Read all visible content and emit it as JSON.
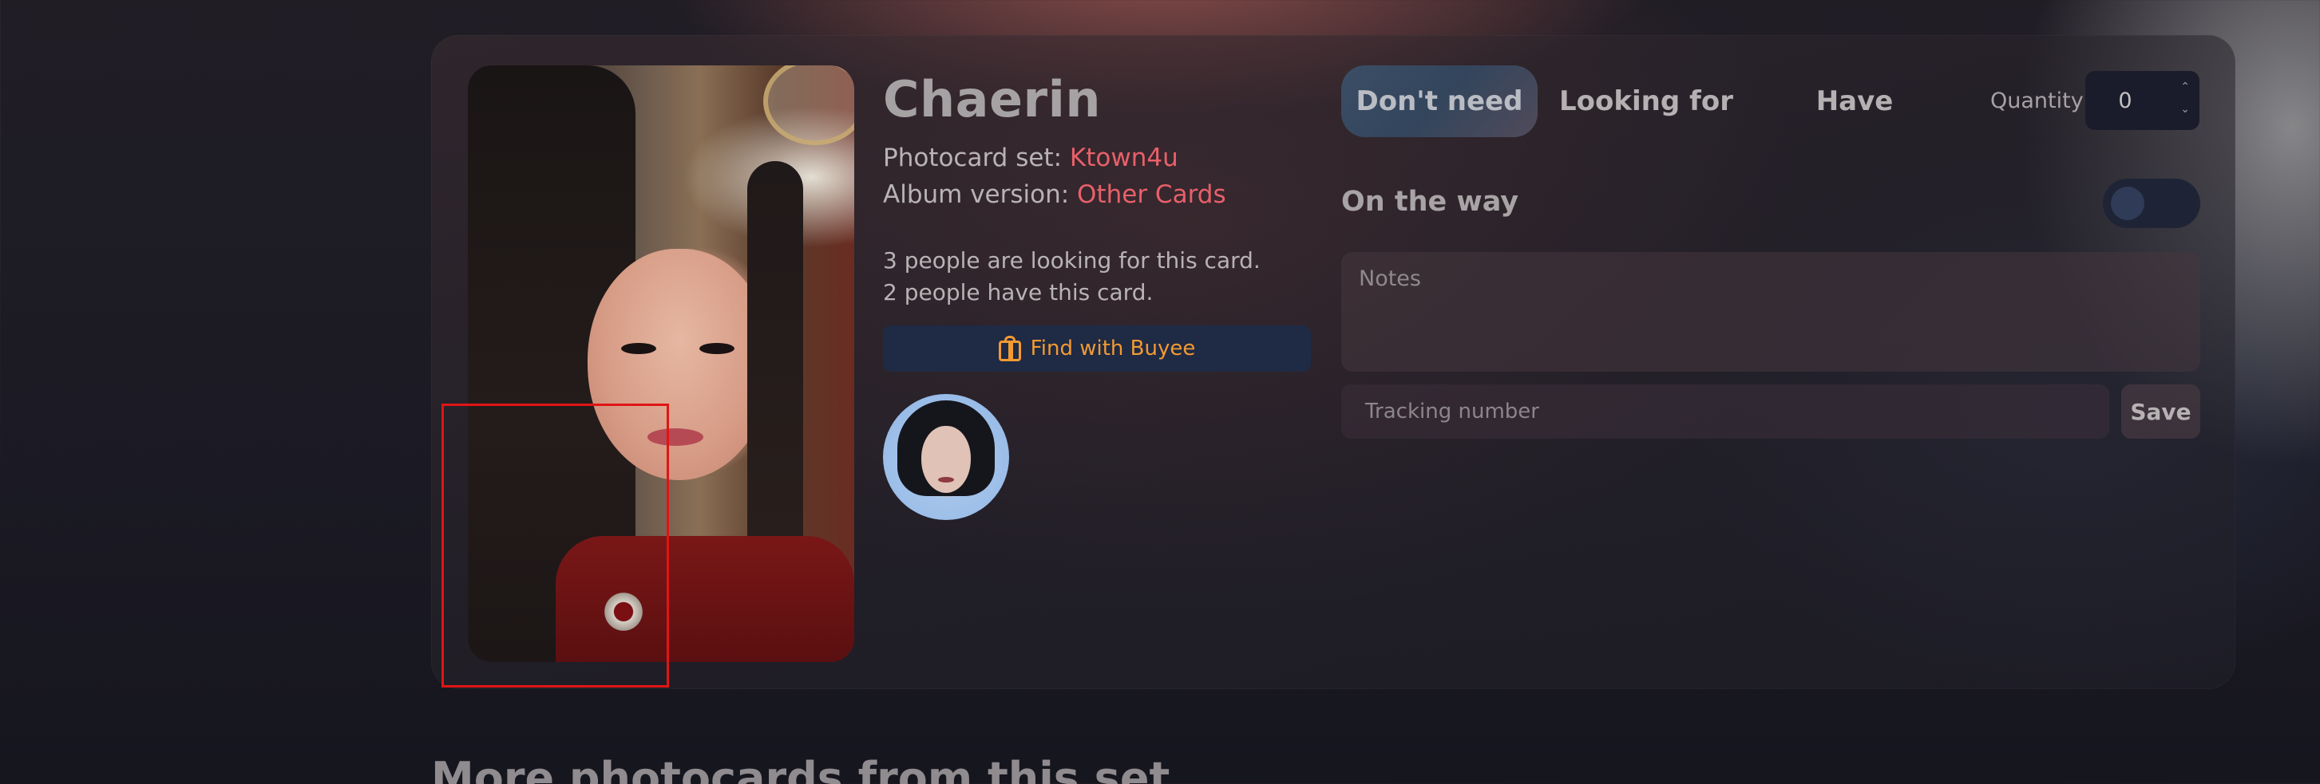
{
  "card": {
    "member_name": "Chaerin",
    "photocard_set_label": "Photocard set: ",
    "photocard_set_value": "Ktown4u",
    "album_version_label": "Album version: ",
    "album_version_value": "Other Cards",
    "looking_count_text": "3 people are looking for this card.",
    "have_count_text": "2 people have this card.",
    "buyee_button_label": "Find with Buyee"
  },
  "status": {
    "options": [
      "Don't need",
      "Looking for",
      "Have"
    ],
    "selected": "Don't need",
    "quantity_label": "Quantity",
    "quantity_value": "0",
    "on_the_way_label": "On the way",
    "on_the_way_enabled": false,
    "notes_placeholder": "Notes",
    "tracking_placeholder": "Tracking number",
    "save_label": "Save"
  },
  "more_section": {
    "title": "More photocards from this set"
  },
  "colors": {
    "link": "#e8606a",
    "buyee_accent": "#f29a32",
    "active_segment": "#3c4e66",
    "highlight": "#e01515"
  }
}
